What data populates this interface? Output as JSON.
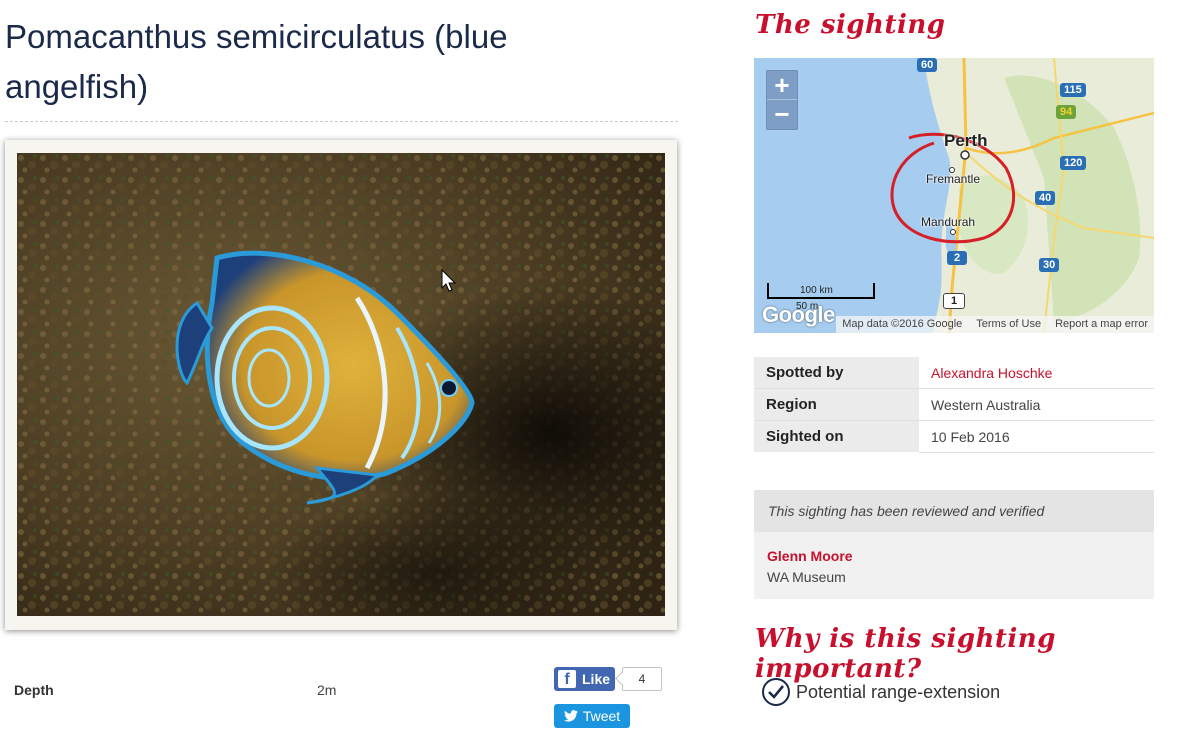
{
  "title": "Pomacanthus semicirculatus (blue angelfish)",
  "photo": {
    "alt": "blue angelfish photo"
  },
  "depth": {
    "label": "Depth",
    "value": "2m"
  },
  "social": {
    "like_label": "Like",
    "like_count": "4",
    "tweet_label": "Tweet",
    "facebook_icon": "facebook-icon",
    "twitter_icon": "twitter-icon"
  },
  "sighting_heading": "The sighting",
  "map": {
    "zoom_in": "+",
    "zoom_out": "−",
    "cities": {
      "perth": "Perth",
      "fremantle": "Fremantle",
      "mandurah": "Mandurah"
    },
    "road_shields": [
      "60",
      "115",
      "94",
      "120",
      "40",
      "30",
      "2",
      "1"
    ],
    "scale_100": "100 km",
    "scale_50": "50 m",
    "google_logo": "Google",
    "attribution": {
      "data": "Map data ©2016 Google",
      "terms": "Terms of Use",
      "report": "Report a map error"
    }
  },
  "details": {
    "spotted_by_label": "Spotted by",
    "spotted_by": "Alexandra Hoschke",
    "region_label": "Region",
    "region": "Western Australia",
    "sighted_on_label": "Sighted on",
    "sighted_on": "10 Feb 2016"
  },
  "verification": {
    "note": "This sighting has been reviewed and verified",
    "name": "Glenn Moore",
    "org": "WA Museum"
  },
  "important_heading": "Why is this sighting important?",
  "reason": "Potential range-extension",
  "colors": {
    "title": "#1b2a4a",
    "accent_red": "#c8102e",
    "facebook": "#4267b2",
    "twitter": "#1b95e0"
  }
}
